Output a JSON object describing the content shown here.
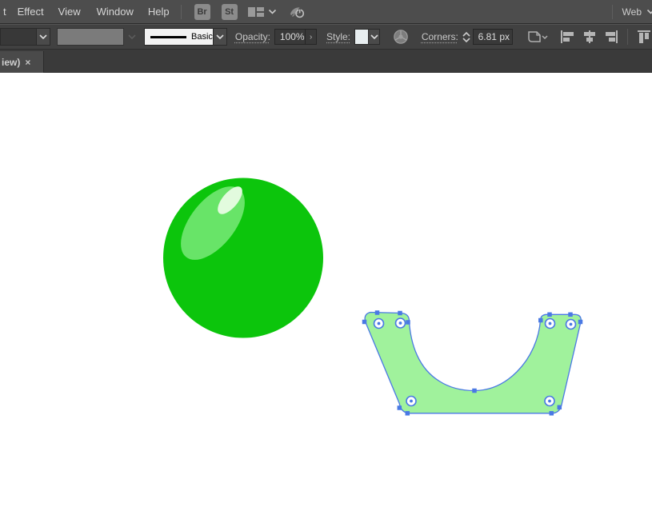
{
  "colors": {
    "selection_blue": "#4A79E4",
    "ball_base": "#0CC50C",
    "ball_highlight": "#68E468",
    "ball_shine": "#E2FBDE",
    "ushape_fill": "#A0F29C",
    "menubar_bg": "#4D4D4D",
    "controlbar_bg": "#414141",
    "tabbar_bg": "#3A3A3A"
  },
  "menubar": {
    "partial_item": "t",
    "items": [
      "Effect",
      "View",
      "Window",
      "Help"
    ],
    "bridge_label": "Br",
    "stock_label": "St",
    "workspace_label": "Web"
  },
  "controlbar": {
    "brush_name": "Basic",
    "opacity_label": "Opacity:",
    "opacity_value": "100%",
    "opacity_arrow": "›",
    "style_label": "Style:",
    "corners_label": "Corners:",
    "corners_value": "6.81 px"
  },
  "tabbar": {
    "tab_label": "iew)",
    "close_glyph": "×"
  }
}
